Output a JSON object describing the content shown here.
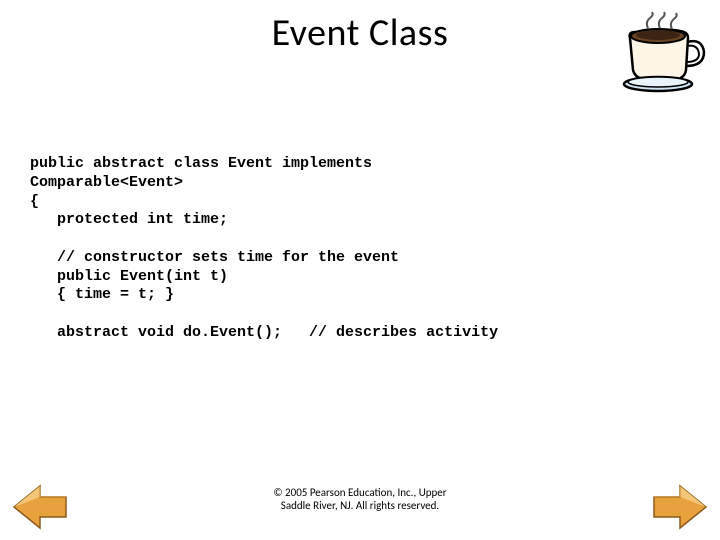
{
  "title": "Event Class",
  "code": {
    "line1": "public abstract class Event implements",
    "line2": "Comparable<Event>",
    "line3": "{",
    "line4": "   protected int time;",
    "line5": "",
    "line6": "   // constructor sets time for the event",
    "line7": "   public Event(int t)",
    "line8": "   { time = t; }",
    "line9": "",
    "line10": "   abstract void do.Event();   // describes activity"
  },
  "footer": {
    "line1": "© 2005 Pearson Education, Inc., Upper",
    "line2": "Saddle River, NJ.  All rights reserved."
  },
  "icons": {
    "coffee": "coffee-cup-icon",
    "prev": "previous-arrow-icon",
    "next": "next-arrow-icon"
  }
}
